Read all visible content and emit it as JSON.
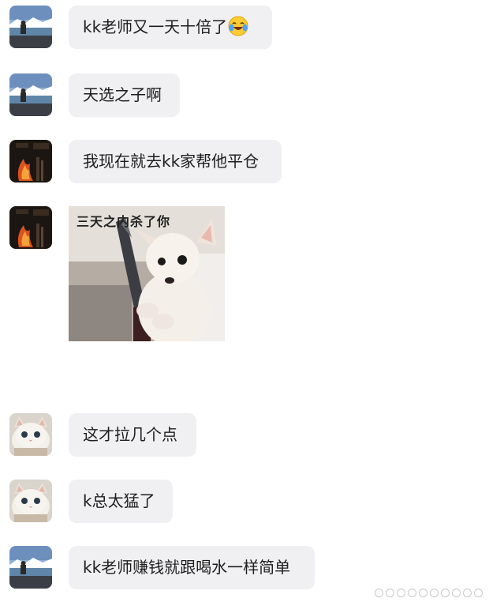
{
  "chat": {
    "messages": [
      {
        "text": "kk老师又一天十倍了",
        "emoji": "laughing-tears-emoji"
      },
      {
        "text": "天选之子啊"
      },
      {
        "text": "我现在就去kk家帮他平仓"
      },
      {
        "sticker_caption": "三天之内杀了你"
      },
      {
        "text": "这才拉几个点"
      },
      {
        "text": "k总太猛了"
      },
      {
        "text": "kk老师赚钱就跟喝水一样简单"
      }
    ]
  },
  "colors": {
    "bubble_bg": "#f0f0f2",
    "text": "#1e1e1e",
    "page_bg": "#ffffff"
  }
}
